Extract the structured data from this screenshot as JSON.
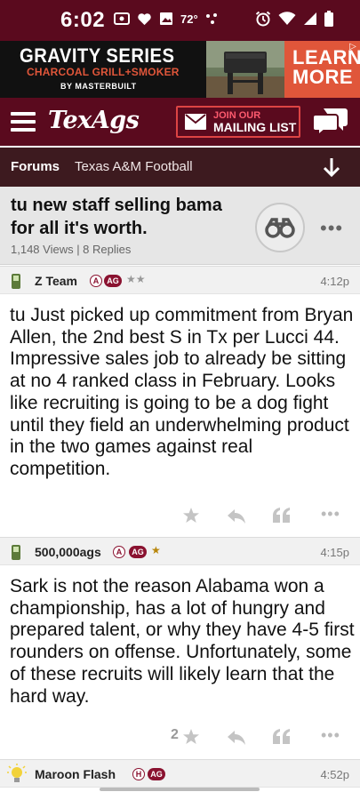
{
  "status_bar": {
    "time": "6:02",
    "temperature": "72°",
    "icons": [
      "screen-cast-icon",
      "heart-icon",
      "image-icon",
      "dots-icon",
      "alarm-icon",
      "wifi-icon",
      "signal-icon",
      "battery-icon"
    ]
  },
  "ad": {
    "line1": "GRAVITY SERIES",
    "line2": "CHARCOAL GRILL+SMOKER",
    "line3": "BY MASTERBUILT",
    "cta_line1": "LEARN",
    "cta_line2": "MORE",
    "colors": {
      "accent": "#e0563a"
    }
  },
  "header": {
    "logo": "TexAgs",
    "mailing_line1": "JOIN OUR",
    "mailing_line2": "MAILING LIST",
    "colors": {
      "primary": "#5a0a1e"
    }
  },
  "breadcrumb": {
    "forums": "Forums",
    "topic": "Texas A&M Football"
  },
  "thread": {
    "title": "tu new staff selling bama for all it's worth.",
    "meta": "1,148 Views | 8 Replies"
  },
  "posts": [
    {
      "user": "Z Team",
      "badge_a": "A",
      "badge_ag": "AG",
      "rating_stars": 2,
      "time": "4:12p",
      "body": "tu Just picked up commitment from Bryan Allen, the 2nd best S in Tx per Lucci 44. Impressive sales job to already be sitting at no 4 ranked class in February. Looks like recruiting is going to be a dog fight until they field an underwhelming product in the two games against real competition.",
      "star_count": ""
    },
    {
      "user": "500,000ags",
      "badge_a": "A",
      "badge_ag": "AG",
      "rating_stars": 1,
      "time": "4:15p",
      "body": "Sark is not the reason Alabama won a championship, has a lot of hungry and prepared talent, or why they have 4-5 first rounders on offense. Unfortunately, some of these recruits will likely learn that the hard way.",
      "star_count": "2"
    },
    {
      "user": "Maroon Flash",
      "badge_h": "H",
      "badge_ag": "AG",
      "time": "4:52p"
    }
  ]
}
